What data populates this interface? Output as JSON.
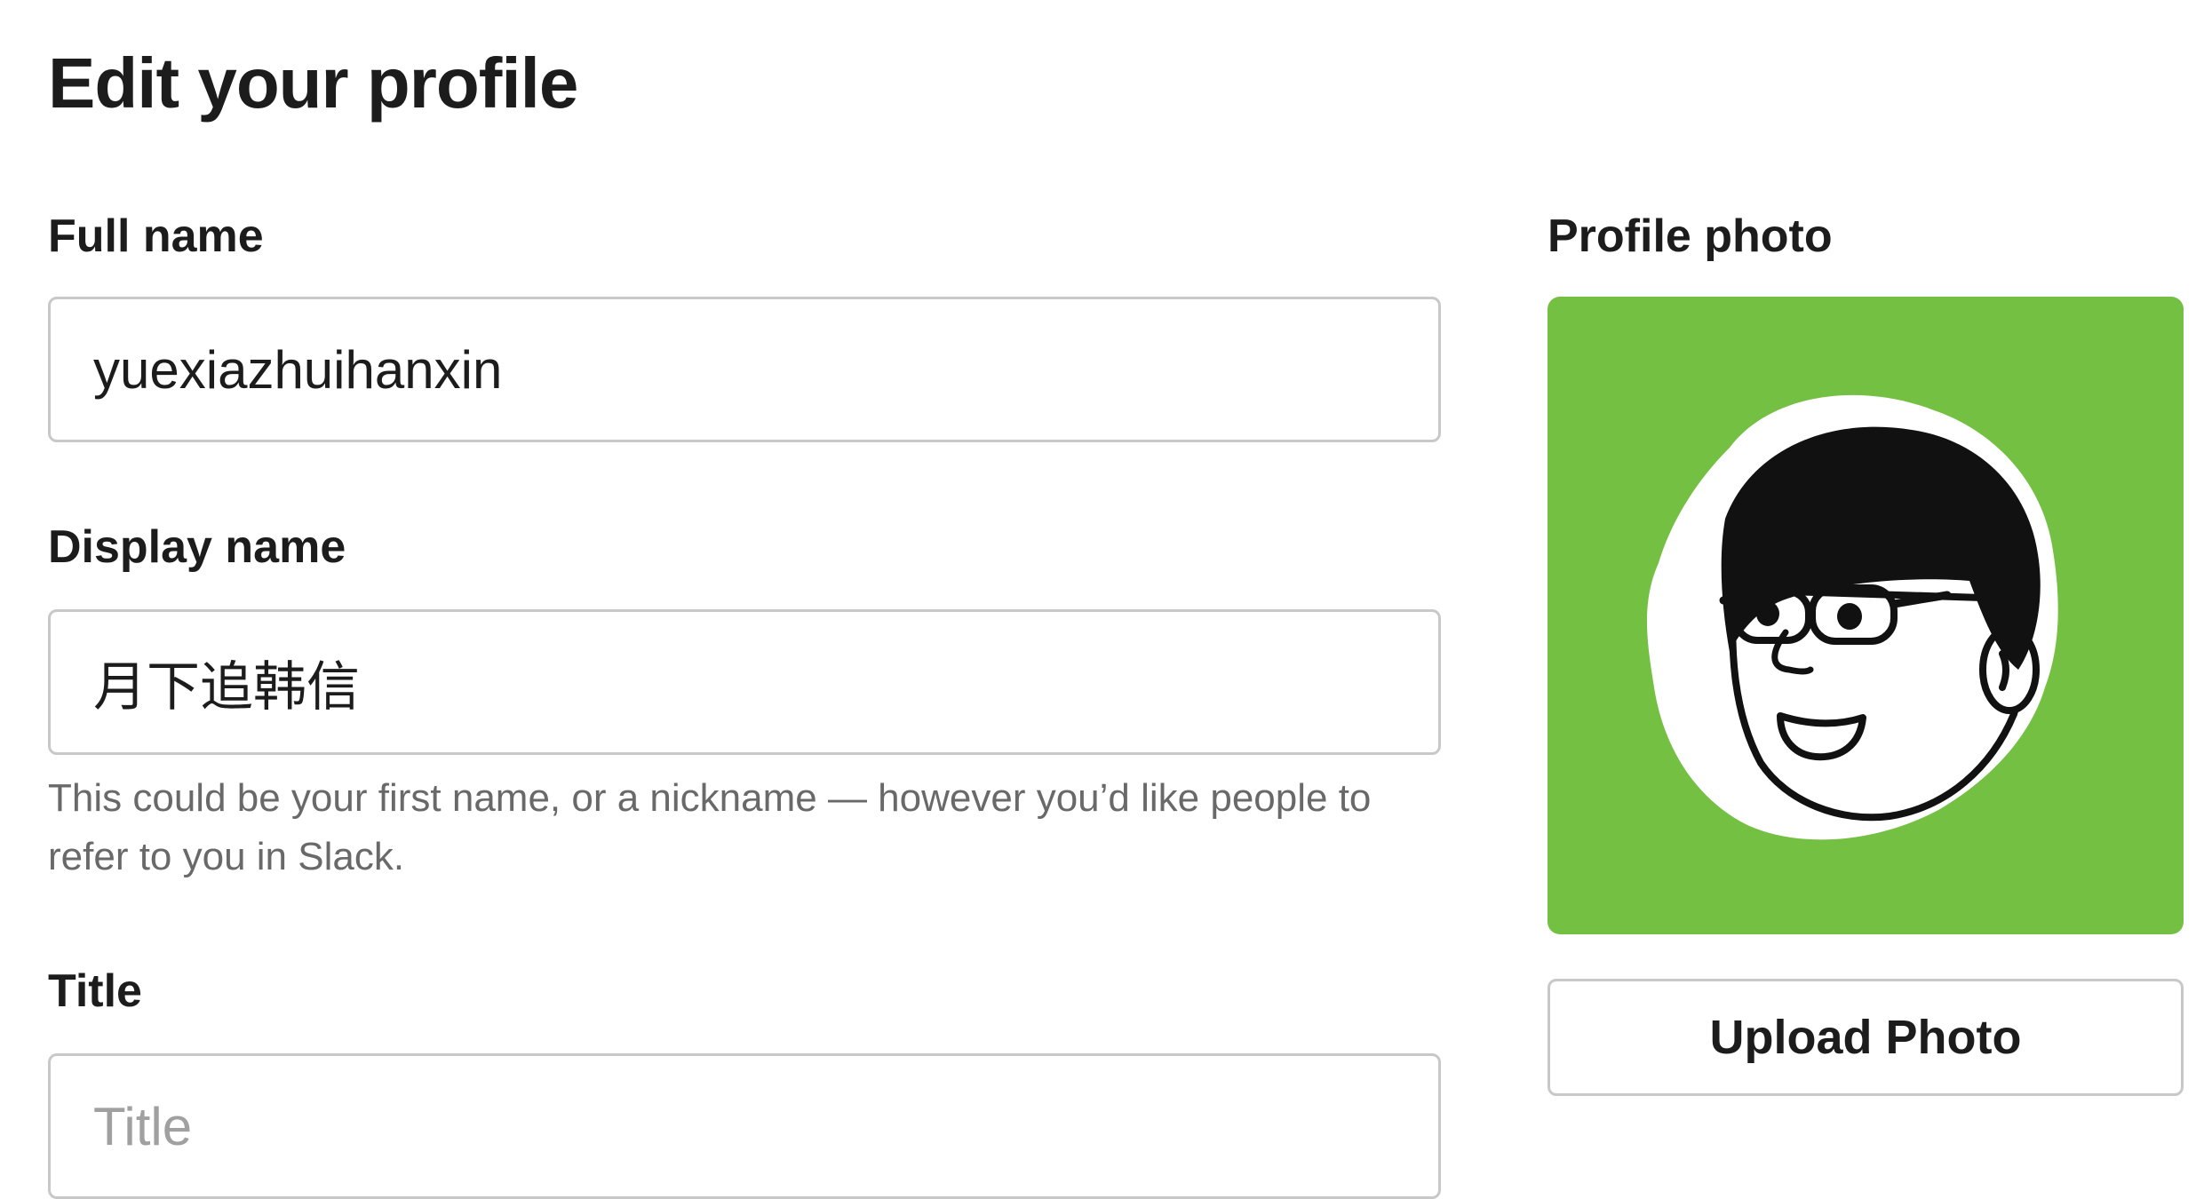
{
  "page": {
    "title": "Edit your profile"
  },
  "form": {
    "full_name": {
      "label": "Full name",
      "value": "yuexiazhuihanxin"
    },
    "display_name": {
      "label": "Display name",
      "value": "月下追韩信",
      "hint": "This could be your first name, or a nickname — however you’d like people to refer to you in Slack."
    },
    "title": {
      "label": "Title",
      "placeholder": "Title"
    }
  },
  "profile_photo": {
    "label": "Profile photo",
    "background_color": "#74c043",
    "avatar_icon": "cartoon-face-with-glasses-icon",
    "upload_button_label": "Upload Photo"
  }
}
